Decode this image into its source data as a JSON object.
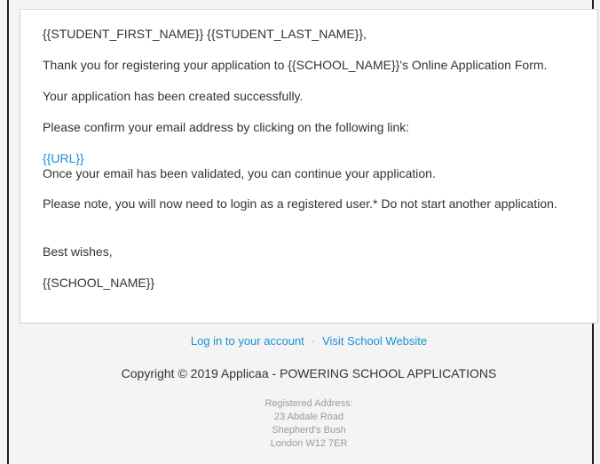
{
  "email": {
    "greeting": "{{STUDENT_FIRST_NAME}} {{STUDENT_LAST_NAME}},",
    "thanks": "Thank you for registering your application to {{SCHOOL_NAME}}'s Online Application Form.",
    "created": "Your application has been created successfully.",
    "confirm": "Please confirm your email address by clicking on the following link:",
    "url_link": "{{URL}}",
    "validated": "Once your email has been validated, you can continue your application.",
    "note": "Please note, you will now need to login as a registered user.* Do not start another application.",
    "closing": "Best wishes,",
    "signature": "{{SCHOOL_NAME}}"
  },
  "footer": {
    "login_link": "Log in to your account",
    "separator": "·",
    "website_link": "Visit School Website",
    "copyright": "Copyright © 2019 Applicaa - POWERING SCHOOL APPLICATIONS",
    "address": {
      "label": "Registered Address:",
      "line1": "23 Abdale Road",
      "line2": "Shepherd's Bush",
      "line3": "London W12 7ER"
    }
  },
  "colors": {
    "link": "#1a8fd6",
    "text": "#333333",
    "muted": "#9a9a9a",
    "background": "#f4f4f4"
  }
}
